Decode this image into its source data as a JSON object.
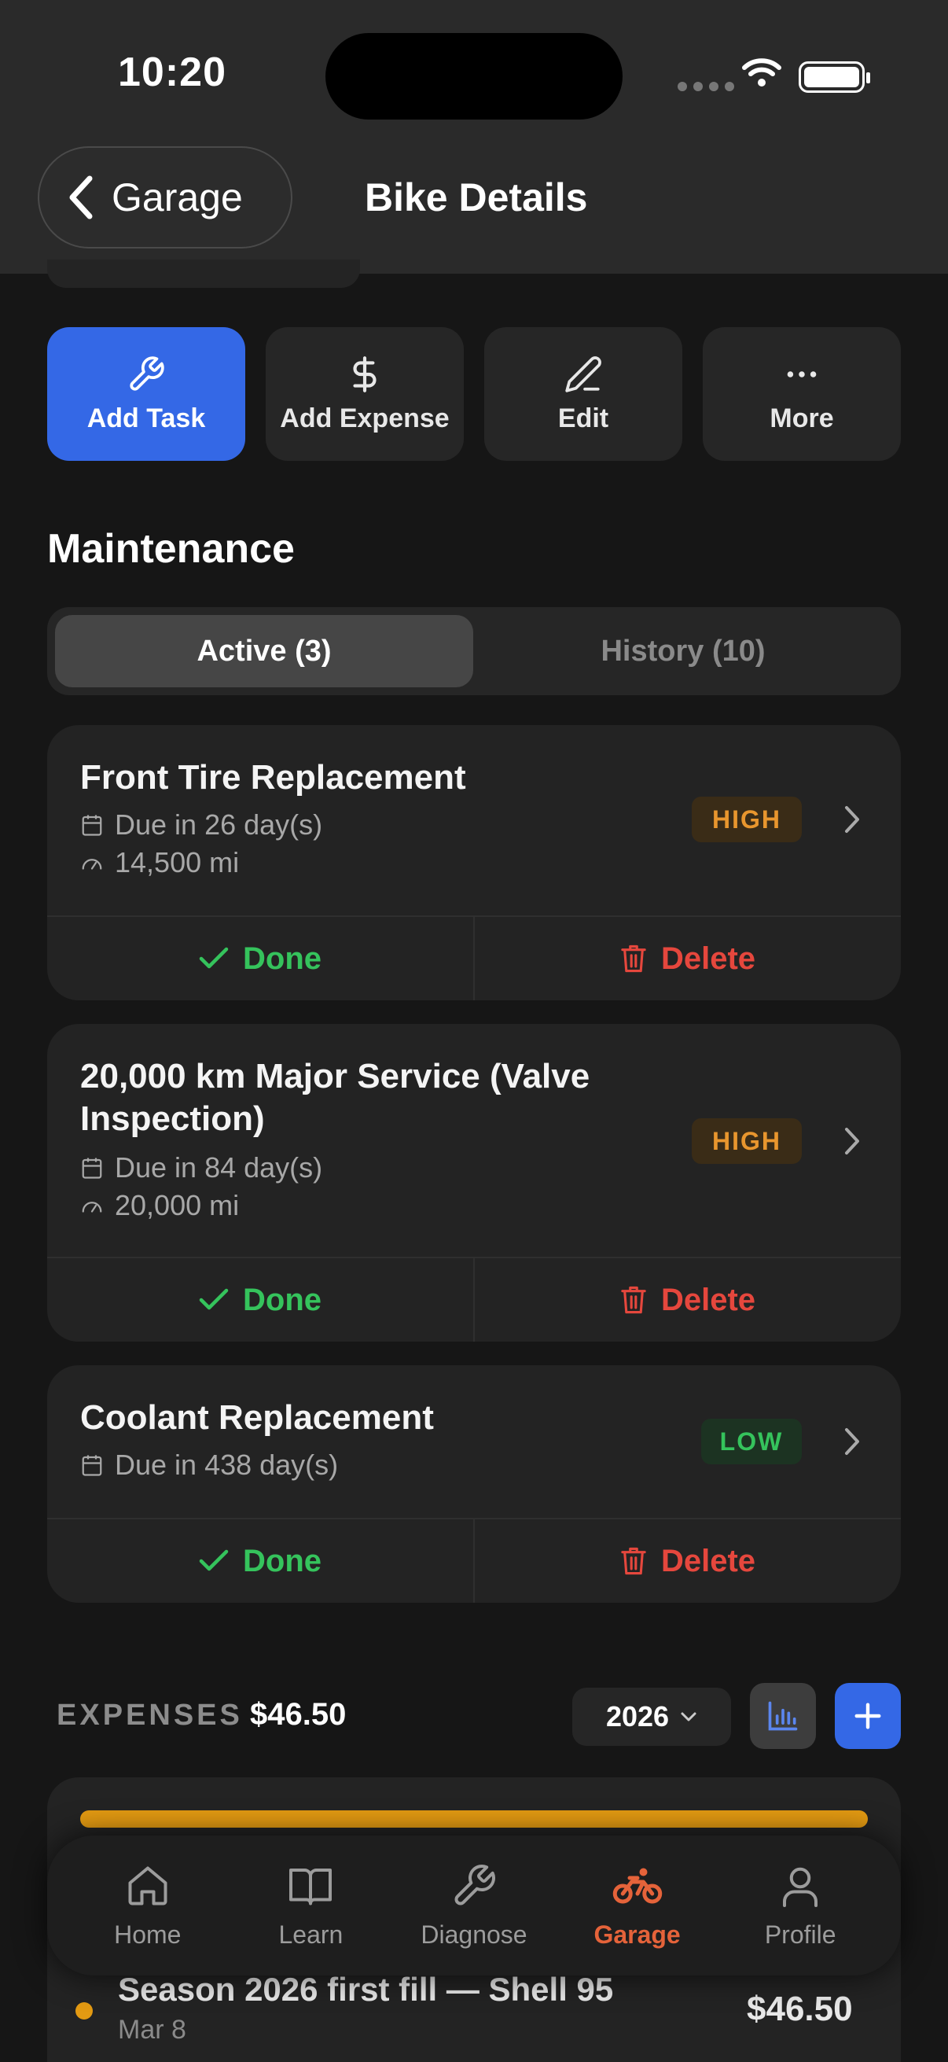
{
  "status_bar": {
    "time": "10:20"
  },
  "header": {
    "back_label": "Garage",
    "title": "Bike Details"
  },
  "actions": [
    {
      "label": "Add Task",
      "icon": "wrench-icon",
      "primary": true
    },
    {
      "label": "Add Expense",
      "icon": "dollar-icon"
    },
    {
      "label": "Edit",
      "icon": "pencil-icon"
    },
    {
      "label": "More",
      "icon": "ellipsis-icon"
    }
  ],
  "maintenance": {
    "heading": "Maintenance",
    "tabs": {
      "active": "Active (3)",
      "history": "History (10)"
    },
    "tasks": [
      {
        "title": "Front Tire Replacement",
        "due": "Due in 26 day(s)",
        "mileage": "14,500 mi",
        "priority": "HIGH",
        "done": "Done",
        "delete": "Delete"
      },
      {
        "title_line1": "20,000 km Major Service (Valve",
        "title_line2": "Inspection)",
        "due": "Due in 84 day(s)",
        "mileage": "20,000 mi",
        "priority": "HIGH",
        "done": "Done",
        "delete": "Delete"
      },
      {
        "title": "Coolant Replacement",
        "due": "Due in 438 day(s)",
        "priority": "LOW",
        "done": "Done",
        "delete": "Delete"
      }
    ]
  },
  "expenses": {
    "label": "EXPENSES",
    "total": "$46.50",
    "year": "2026",
    "items": [
      {
        "name": "Season 2026 first fill — Shell 95",
        "date": "Mar 8",
        "amount": "$46.50"
      }
    ]
  },
  "tabbar": [
    {
      "label": "Home",
      "icon": "home-icon"
    },
    {
      "label": "Learn",
      "icon": "book-icon"
    },
    {
      "label": "Diagnose",
      "icon": "wrench-icon"
    },
    {
      "label": "Garage",
      "icon": "motorcycle-icon",
      "active": true
    },
    {
      "label": "Profile",
      "icon": "person-icon"
    }
  ],
  "colors": {
    "accent": "#3468e6",
    "high": "#e8962e",
    "low": "#35c35c",
    "delete": "#e5473d",
    "active_tab": "#e5633a",
    "expense_bar": "#e39a12"
  }
}
